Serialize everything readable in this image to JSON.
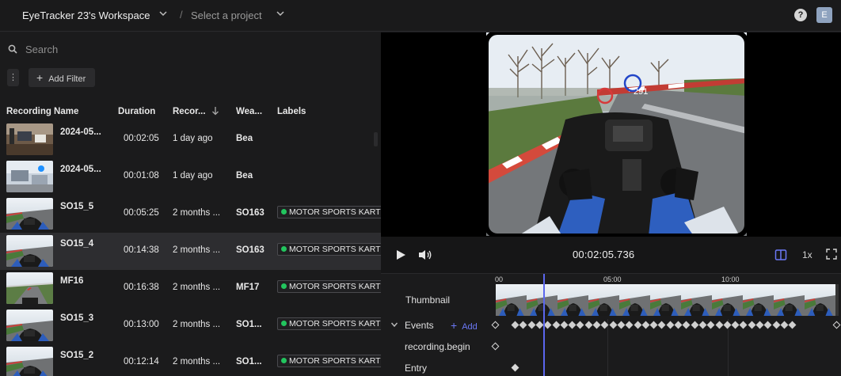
{
  "topbar": {
    "workspace": "EyeTracker 23's Workspace",
    "separator": "/",
    "project_placeholder": "Select a project",
    "help": "?",
    "avatar": "E"
  },
  "left": {
    "search_placeholder": "Search",
    "menu_glyph": "⋮",
    "add_filter": "Add Filter",
    "columns": [
      "Recording Name",
      "Duration",
      "Recor...",
      "Wea...",
      "Labels"
    ],
    "rows": [
      {
        "name": "2024-05...",
        "duration": "00:02:05",
        "recorded": "1 day ago",
        "wearer": "Bea",
        "label": "",
        "thumb": "office1",
        "selected": false
      },
      {
        "name": "2024-05...",
        "duration": "00:01:08",
        "recorded": "1 day ago",
        "wearer": "Bea",
        "label": "",
        "thumb": "office2",
        "selected": false
      },
      {
        "name": "SO15_5",
        "duration": "00:05:25",
        "recorded": "2 months ...",
        "wearer": "SO163",
        "label": "MOTOR SPORTS KART",
        "thumb": "kart",
        "selected": false
      },
      {
        "name": "SO15_4",
        "duration": "00:14:38",
        "recorded": "2 months ...",
        "wearer": "SO163",
        "label": "MOTOR SPORTS KART",
        "thumb": "kart",
        "selected": true
      },
      {
        "name": "MF16",
        "duration": "00:16:38",
        "recorded": "2 months ...",
        "wearer": "MF17",
        "label": "MOTOR SPORTS KART",
        "thumb": "track",
        "selected": false
      },
      {
        "name": "SO15_3",
        "duration": "00:13:00",
        "recorded": "2 months ...",
        "wearer": "SO1...",
        "label": "MOTOR SPORTS KART",
        "thumb": "kart",
        "selected": false
      },
      {
        "name": "SO15_2",
        "duration": "00:12:14",
        "recorded": "2 months ...",
        "wearer": "SO1...",
        "label": "MOTOR SPORTS KART",
        "thumb": "kart",
        "selected": false
      }
    ]
  },
  "video": {
    "gaze_fixation": "291"
  },
  "controls": {
    "time": "00:02:05.736",
    "speed": "1x"
  },
  "timeline": {
    "ticks": [
      "00",
      "05:00",
      "10:00"
    ],
    "thumbnail_label": "Thumbnail",
    "events_label": "Events",
    "add_label": "Add",
    "tracks": [
      "recording.begin",
      "Entry"
    ]
  },
  "colors": {
    "accent": "#5b67ee",
    "label_dot": "#22c55e",
    "selected_row": "#2d2d30"
  }
}
